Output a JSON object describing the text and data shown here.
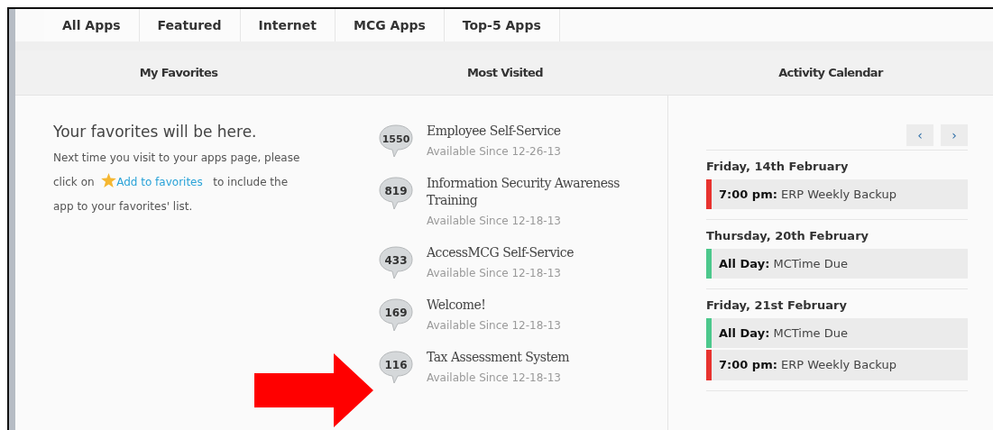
{
  "tabs": [
    {
      "label": "All Apps",
      "selected": false
    },
    {
      "label": "Featured",
      "selected": false
    },
    {
      "label": "Internet",
      "selected": false
    },
    {
      "label": "MCG Apps",
      "selected": false
    },
    {
      "label": "Top-5 Apps",
      "selected": false
    }
  ],
  "sections": [
    "My Favorites",
    "Most Visited",
    "Activity Calendar"
  ],
  "favorites": {
    "heading": "Your favorites will be here.",
    "text_before": "Next time you visit to your apps page, please click on",
    "link": "Add to favorites",
    "text_after": "to include the app to your favorites' list."
  },
  "most_visited": [
    {
      "count": "1550",
      "name": "Employee Self-Service",
      "since": "Available Since 12-26-13"
    },
    {
      "count": "819",
      "name": "Information Security Awareness Training",
      "since": "Available Since 12-18-13"
    },
    {
      "count": "433",
      "name": "AccessMCG Self-Service",
      "since": "Available Since 12-18-13"
    },
    {
      "count": "169",
      "name": "Welcome!",
      "since": "Available Since 12-18-13"
    },
    {
      "count": "116",
      "name": "Tax Assessment System",
      "since": "Available Since 12-18-13"
    }
  ],
  "calendar": {
    "prev": "‹",
    "next": "›",
    "days": [
      {
        "date": "Friday, 14th February",
        "events": [
          {
            "text": "**7:00 pm:** ERP Weekly Backup",
            "color": "#e8332f"
          }
        ]
      },
      {
        "date": "Thursday, 20th February",
        "events": [
          {
            "text": "**All Day:** MCTime Due",
            "color": "#4cc88c"
          }
        ]
      },
      {
        "date": "Friday, 21st February",
        "events": [
          {
            "text": "**All Day:** MCTime Due",
            "color": "#4cc88c"
          },
          {
            "text": "**7:00 pm:** ERP Weekly Backup",
            "color": "#e8332f"
          }
        ]
      }
    ]
  }
}
